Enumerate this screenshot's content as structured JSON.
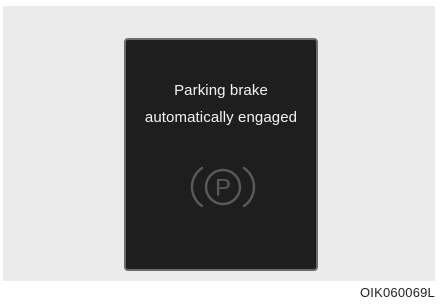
{
  "display": {
    "message_line1": "Parking brake",
    "message_line2": "automatically engaged",
    "icon": {
      "name": "parking-brake-icon",
      "glyph": "P",
      "color": "#5a5a5a"
    }
  },
  "figure_code": "OIK060069L",
  "colors": {
    "panel_bg": "#ebebeb",
    "display_bg": "#1e1e1e",
    "display_border": "#6b6b6b",
    "message_text": "#f2f2f2"
  }
}
